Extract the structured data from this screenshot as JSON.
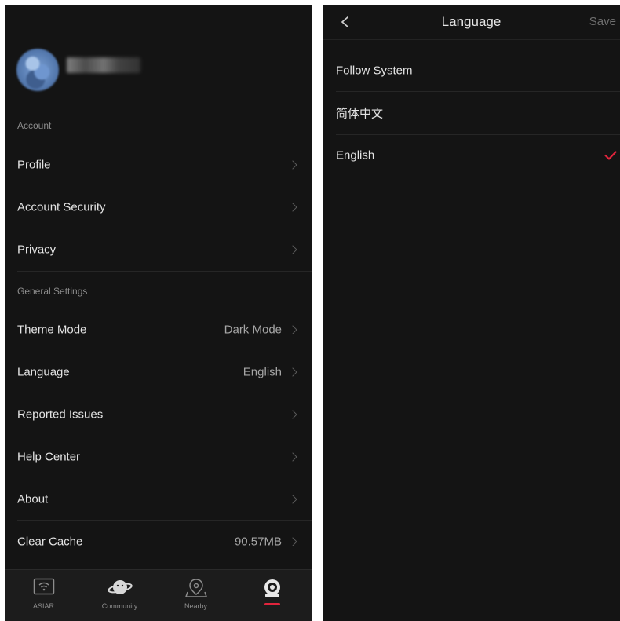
{
  "settings": {
    "account_section": "Account",
    "account_items": [
      {
        "label": "Profile"
      },
      {
        "label": "Account Security"
      },
      {
        "label": "Privacy"
      }
    ],
    "general_section": "General Settings",
    "general_items": [
      {
        "label": "Theme Mode",
        "value": "Dark Mode"
      },
      {
        "label": "Language",
        "value": "English"
      },
      {
        "label": "Reported Issues"
      },
      {
        "label": "Help Center"
      },
      {
        "label": "About"
      },
      {
        "label": "Clear Cache",
        "value": "90.57MB"
      }
    ]
  },
  "tabbar": {
    "tabs": [
      {
        "label": "ASIAR",
        "icon": "wifi-screen-icon"
      },
      {
        "label": "Community",
        "icon": "planet-icon"
      },
      {
        "label": "Nearby",
        "icon": "map-pin-icon"
      },
      {
        "label": "",
        "icon": "robot-profile-icon",
        "active": true
      }
    ]
  },
  "language_screen": {
    "title": "Language",
    "save_label": "Save",
    "options": [
      {
        "label": "Follow System",
        "selected": false
      },
      {
        "label": "简体中文",
        "selected": false
      },
      {
        "label": "English",
        "selected": true
      }
    ]
  },
  "colors": {
    "background": "#141414",
    "accent": "#e0243c",
    "text_primary": "#e4e4e4",
    "text_secondary": "#8c8c8c"
  }
}
